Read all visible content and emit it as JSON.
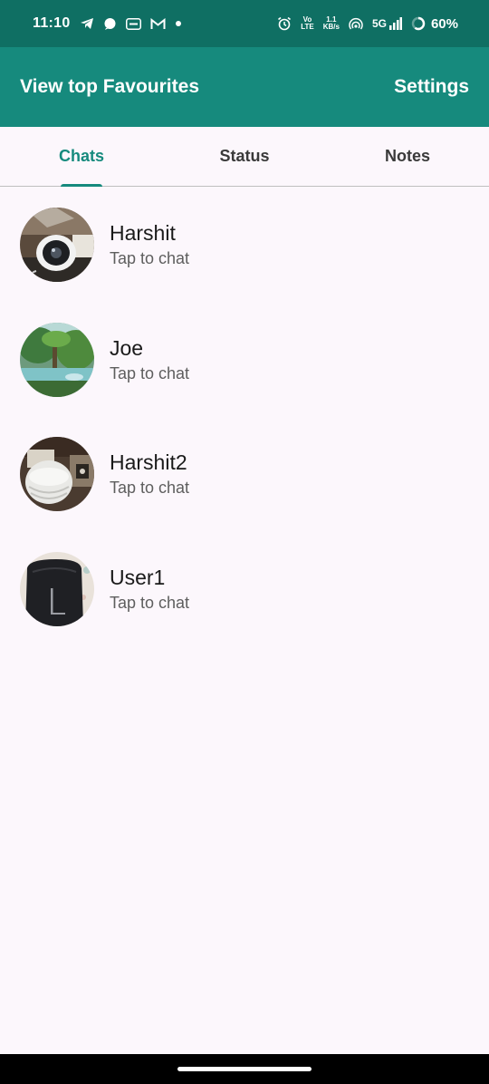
{
  "status_bar": {
    "time": "11:10",
    "left_icons": [
      "telegram-icon",
      "chat-bubble-icon",
      "app-badge-icon",
      "gmail-icon",
      "dot-icon"
    ],
    "right_icons": [
      "alarm-icon",
      "volte-icon",
      "data-speed-icon",
      "hotspot-icon",
      "signal-icon",
      "battery-icon"
    ],
    "volte_top": "Vo",
    "volte_bottom": "LTE",
    "speed_top": "1.1",
    "speed_bottom": "KB/s",
    "network": "5G",
    "battery": "60%"
  },
  "app_bar": {
    "left_action": "View top Favourites",
    "right_action": "Settings",
    "color": "#168a7d"
  },
  "tabs": [
    {
      "label": "Chats",
      "active": true
    },
    {
      "label": "Status",
      "active": false
    },
    {
      "label": "Notes",
      "active": false
    }
  ],
  "chats": [
    {
      "name": "Harshit",
      "subtitle": "Tap to chat",
      "avatar": "camera-photo"
    },
    {
      "name": "Joe",
      "subtitle": "Tap to chat",
      "avatar": "forest-painting"
    },
    {
      "name": "Harshit2",
      "subtitle": "Tap to chat",
      "avatar": "speaker-photo"
    },
    {
      "name": "User1",
      "subtitle": "Tap to chat",
      "avatar": "backpack-photo"
    }
  ]
}
